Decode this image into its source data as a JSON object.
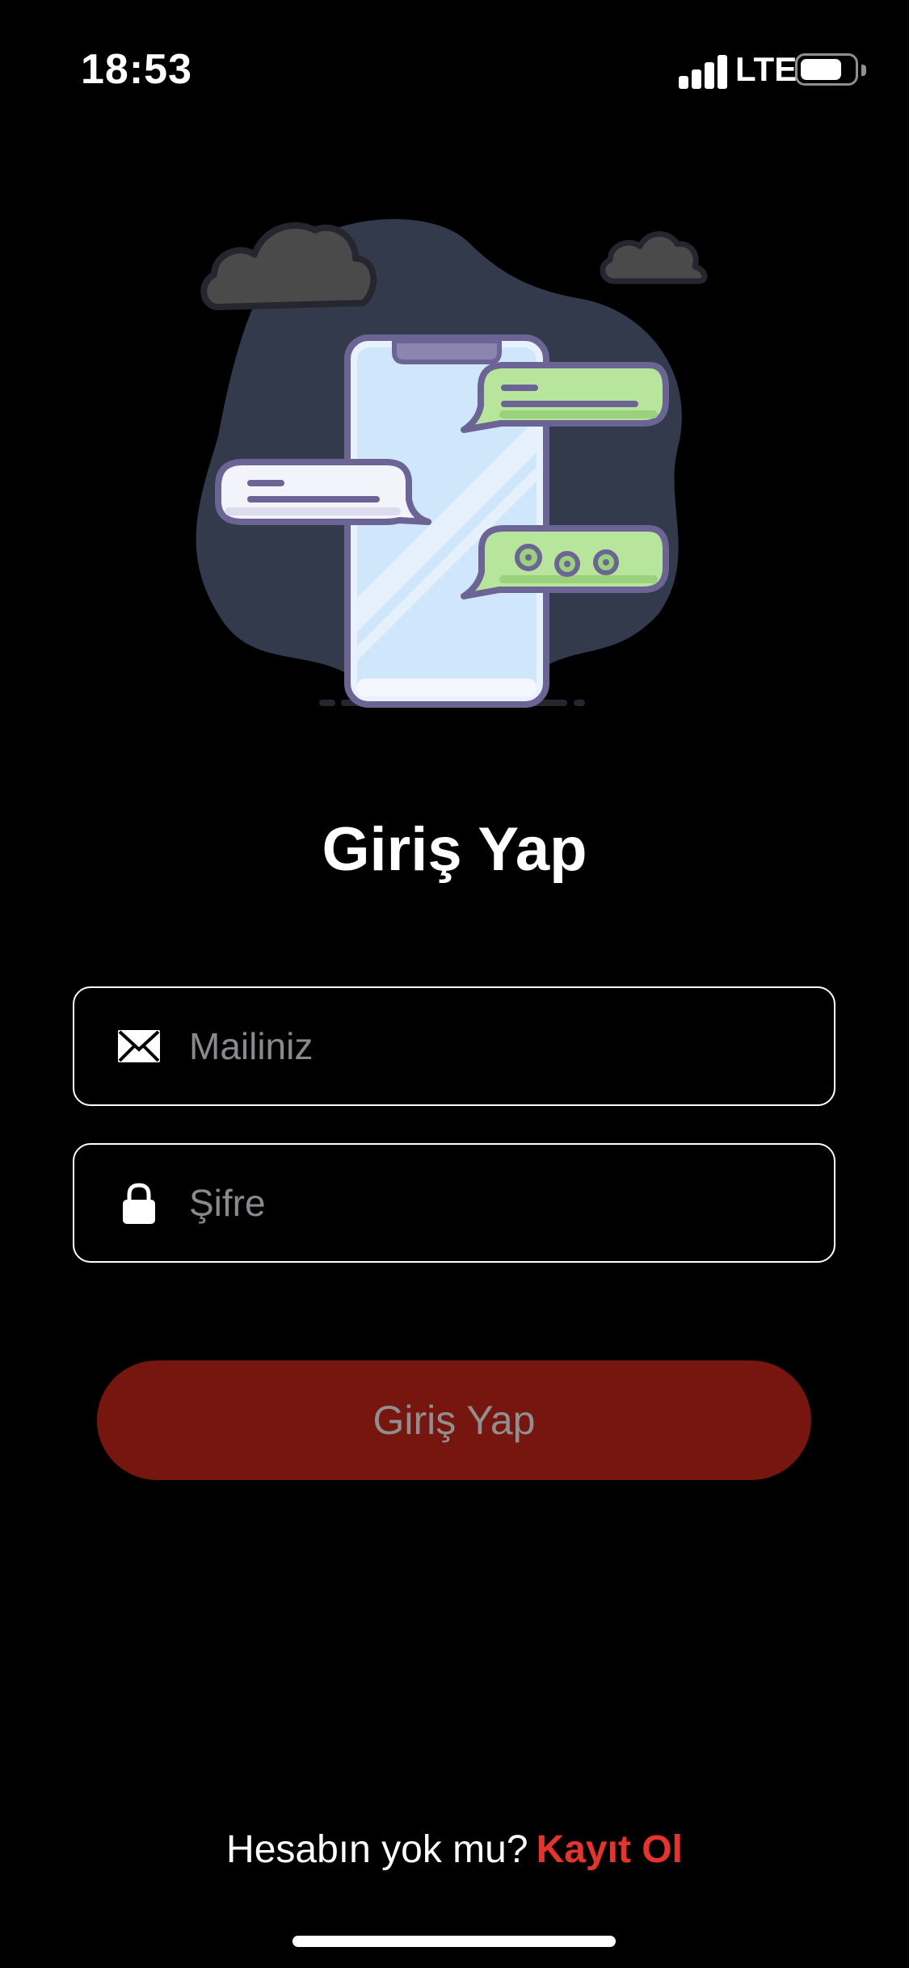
{
  "status_bar": {
    "time": "18:53",
    "network": "LTE",
    "icons": [
      "signal-icon",
      "battery-icon"
    ]
  },
  "illustration": {
    "icon": "chat-phone-illustration",
    "colors": {
      "blob": "#323a4b",
      "cloud": "#4a4a4a",
      "outline": "#6b6494",
      "screen": "#cfe6fb",
      "bubble_green": "#b7e59c",
      "bubble_white": "#f2f3fb"
    }
  },
  "page": {
    "title": "Giriş Yap"
  },
  "form": {
    "email": {
      "placeholder": "Mailiniz",
      "value": "",
      "icon": "mail-icon"
    },
    "password": {
      "placeholder": "Şifre",
      "value": "",
      "icon": "lock-icon"
    },
    "submit_label": "Giriş Yap"
  },
  "footer": {
    "question": "Hesabın yok mu?",
    "signup_label": "Kayıt Ol"
  },
  "colors": {
    "background": "#000000",
    "button": "#77150f",
    "button_text": "#8f8f8f",
    "accent": "#e8332a",
    "placeholder": "#8a8a8e"
  }
}
